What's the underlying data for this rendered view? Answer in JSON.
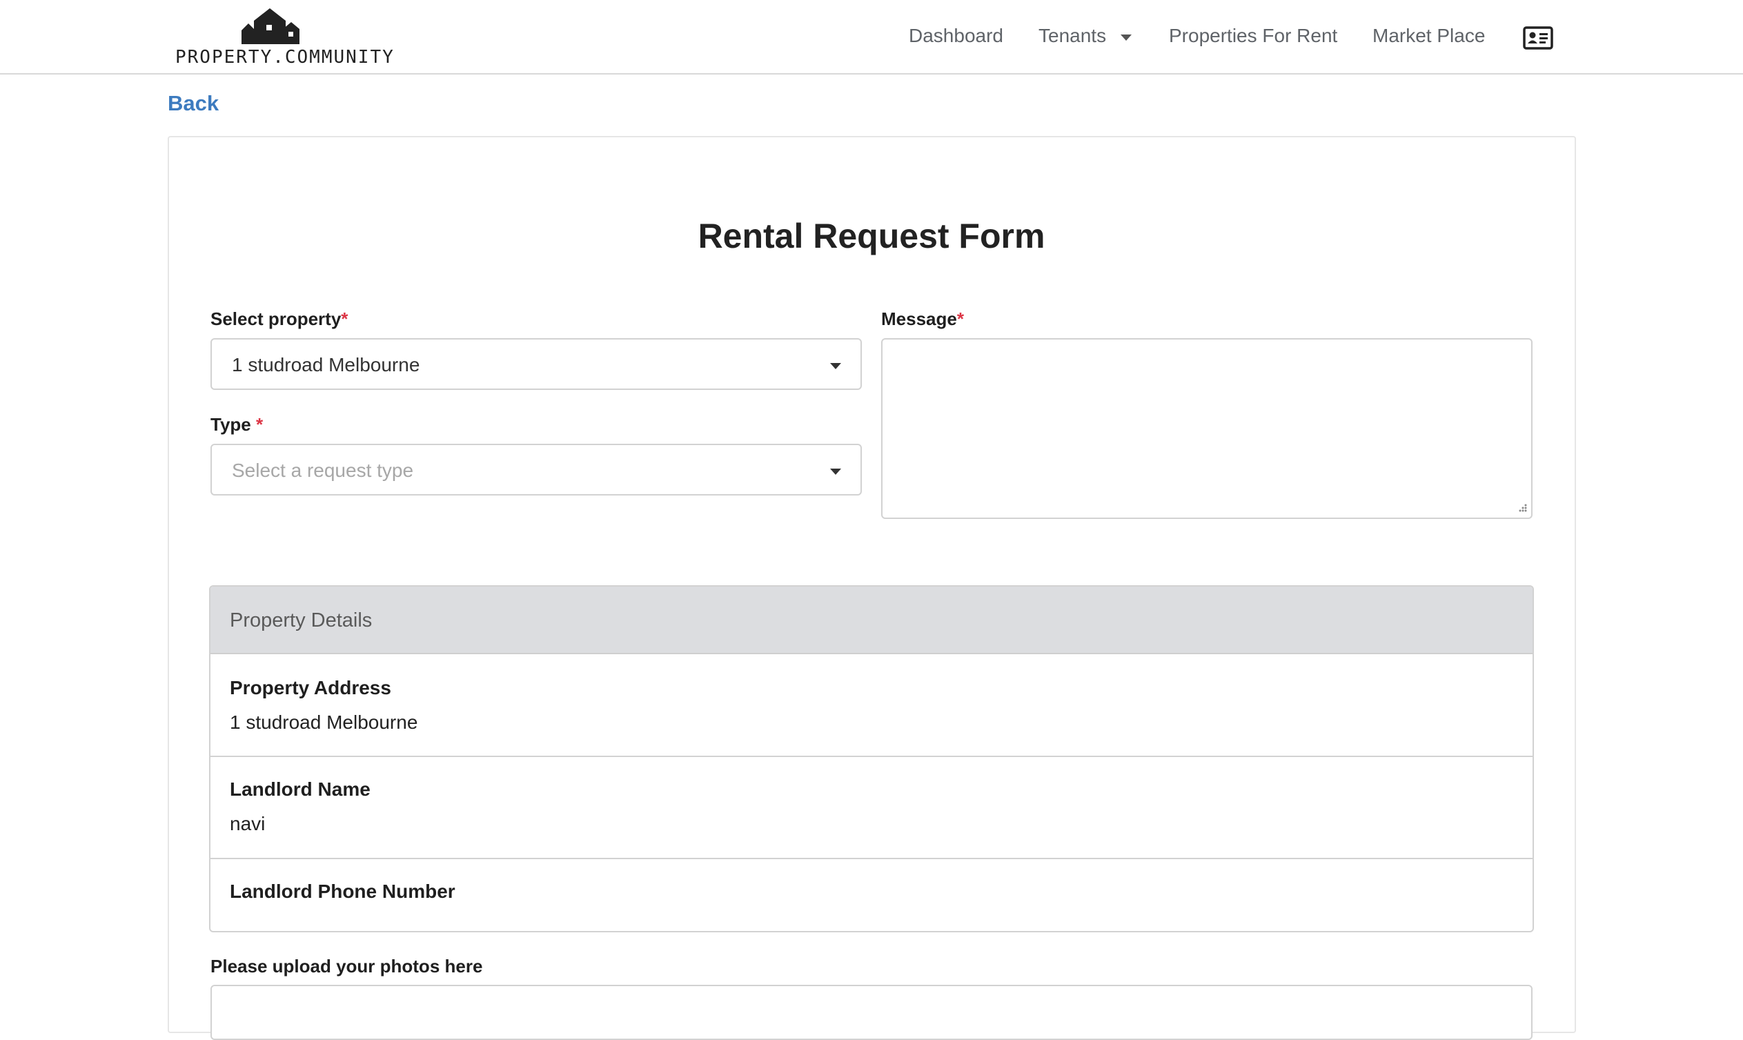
{
  "brand": {
    "logo_text": "PROPERTY.COMMUNITY",
    "logo_icon": "houses-icon"
  },
  "nav": {
    "dashboard": "Dashboard",
    "tenants": "Tenants",
    "properties_for_rent": "Properties For Rent",
    "market_place": "Market Place",
    "profile_icon": "id-card-icon"
  },
  "back_label": "Back",
  "form": {
    "title": "Rental Request Form",
    "select_property": {
      "label": "Select property",
      "required_mark": "*",
      "value": "1 studroad Melbourne"
    },
    "type": {
      "label": "Type ",
      "required_mark": "*",
      "placeholder": "Select a request type"
    },
    "message": {
      "label": "Message",
      "required_mark": "*",
      "value": ""
    }
  },
  "property_details": {
    "heading": "Property Details",
    "address_label": "Property Address",
    "address_value": "1 studroad Melbourne",
    "landlord_name_label": "Landlord Name",
    "landlord_name_value": "navi",
    "landlord_phone_label": "Landlord Phone Number",
    "landlord_phone_value": ""
  },
  "upload": {
    "label": "Please upload your photos here"
  },
  "colors": {
    "link": "#3d7bbf",
    "required": "#dc3545",
    "panel_header": "#dcdde0"
  }
}
